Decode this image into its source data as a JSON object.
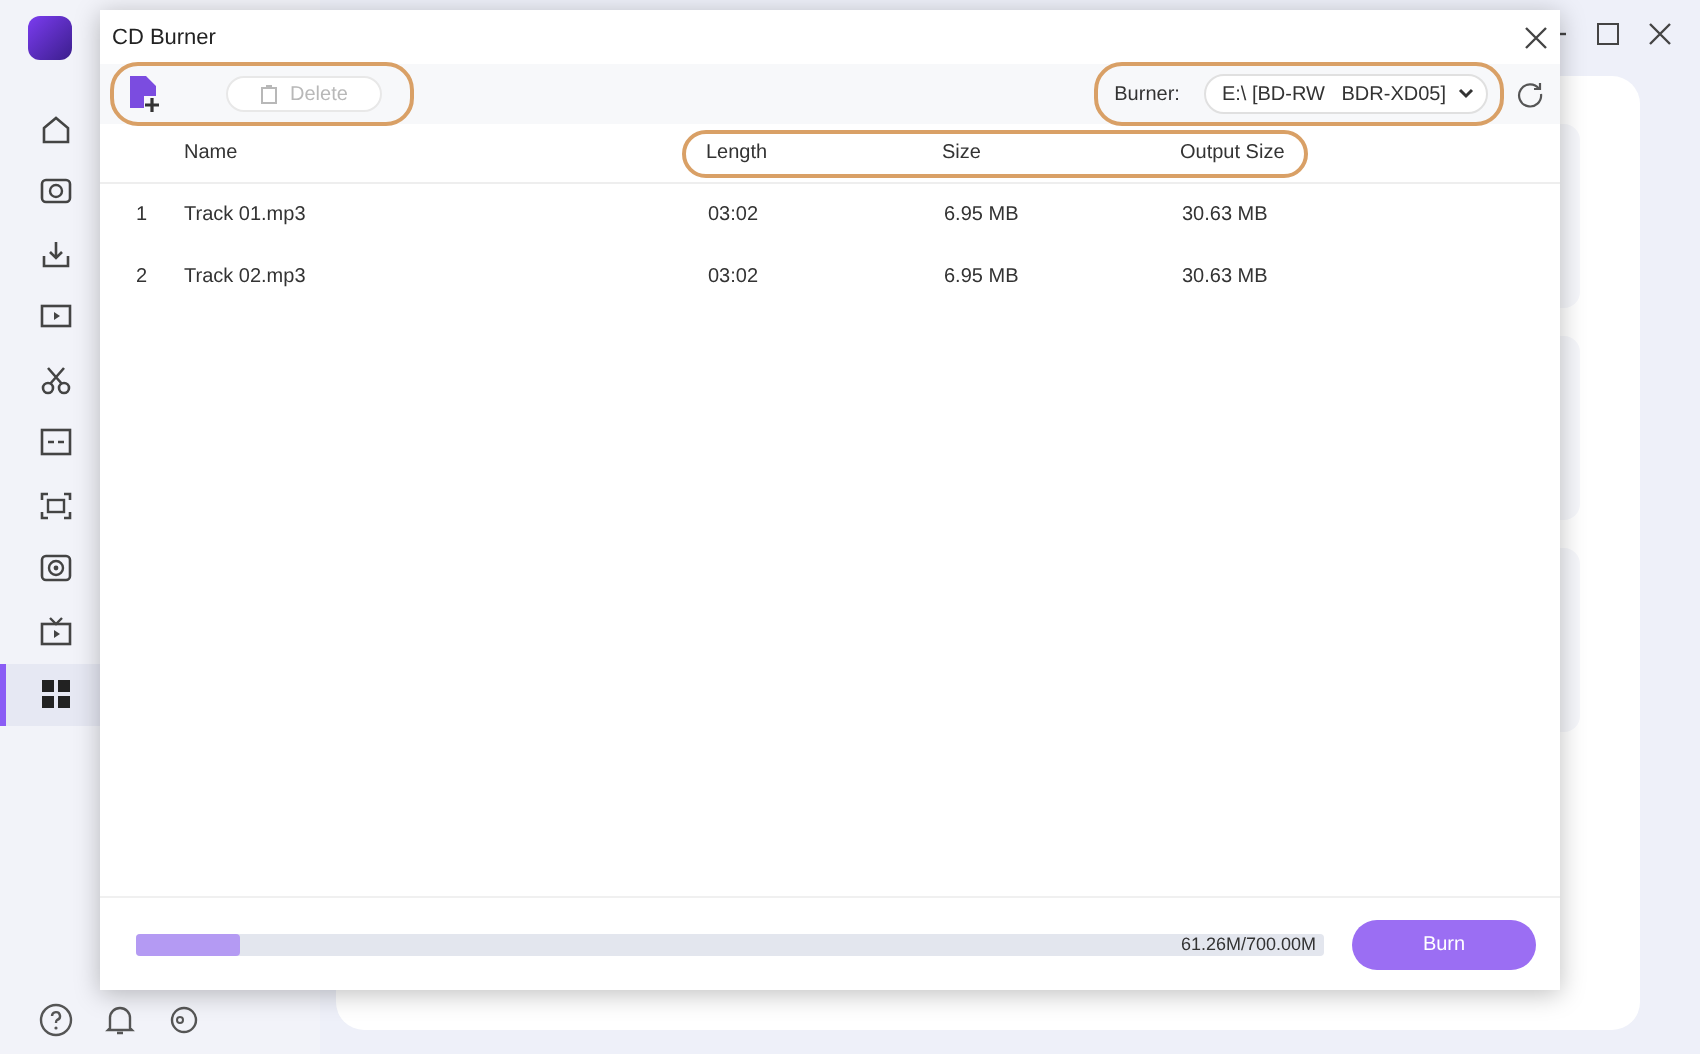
{
  "background_app": {
    "sidebar": {
      "items": [
        {
          "selected": false
        },
        {
          "selected": false
        },
        {
          "selected": false
        },
        {
          "selected": false
        },
        {
          "selected": false
        },
        {
          "selected": false
        },
        {
          "selected": false
        },
        {
          "selected": false
        },
        {
          "selected": false
        },
        {
          "selected": true
        }
      ]
    }
  },
  "dialog": {
    "title": "CD Burner",
    "toolbar": {
      "delete_button": {
        "label": "Delete",
        "disabled": true
      },
      "burner_label": "Burner:",
      "burner_value": "E:\\ [BD-RW   BDR-XD05]"
    },
    "table": {
      "columns": [
        "Name",
        "Length",
        "Size",
        "Output Size"
      ],
      "rows": [
        {
          "index": "1",
          "name": "Track 01.mp3",
          "length": "03:02",
          "size": "6.95 MB",
          "output_size": "30.63 MB"
        },
        {
          "index": "2",
          "name": "Track 02.mp3",
          "length": "03:02",
          "size": "6.95 MB",
          "output_size": "30.63 MB"
        }
      ]
    },
    "footer": {
      "capacity": {
        "level": 0.0875,
        "reading": "61.26M/700.00M"
      },
      "burn_button": "Burn"
    }
  }
}
